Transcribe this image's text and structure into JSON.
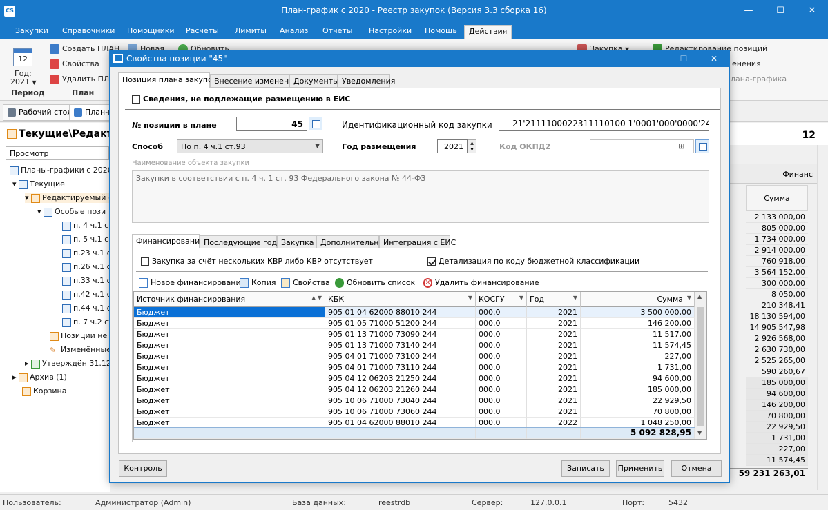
{
  "app": {
    "title": "План-график с 2020 - Реестр закупок (Версия 3.3 сборка 16)",
    "icon_label": "CS",
    "accent": "#1979ca"
  },
  "window_controls": {
    "minimize": "—",
    "maximize": "☐",
    "close": "✕"
  },
  "menu": {
    "items": [
      "Закупки",
      "Справочники",
      "Помощники",
      "Расчёты",
      "Лимиты",
      "Анализ",
      "Отчёты",
      "Настройки",
      "Помощь",
      "Действия"
    ]
  },
  "ribbon": {
    "year_label": "Год:",
    "year_value": "2021",
    "calendar_day": "12",
    "period_group": "Период",
    "create_plan": "Создать ПЛАН",
    "properties": "Свойства",
    "delete_plan": "Удалить ПЛАН",
    "plan_group": "План",
    "new_label": "Новая",
    "refresh_label": "Обновить",
    "purchase_label": "Закупка",
    "edit_positions": "Редактирование позиций",
    "changes_label": "енения",
    "plan_schedule_group": "лана-графика"
  },
  "doc_tabs": [
    "Рабочий стол",
    "План-г"
  ],
  "tree": {
    "title": "Текущие\\Редакти",
    "view_mode": "Просмотр",
    "items": [
      "Планы-графики с 2020",
      "Текущие",
      "Редактируемый (",
      "Особые пози",
      "п. 4 ч.1 с",
      "п. 5 ч.1 с",
      "п.23 ч.1 с",
      "п.26 ч.1 с",
      "п.33 ч.1 с",
      "п.42 ч.1 с",
      "п.44 ч.1 с",
      "п. 7 ч.2 ст",
      "Позиции не д",
      "Изменённые",
      "Утверждён 31.12",
      "Архив (1)",
      "Корзина"
    ]
  },
  "background_table": {
    "count": "12",
    "financing_header": "Финанс",
    "sum_header": "Сумма",
    "values": [
      "2 133 000,00",
      "805 000,00",
      "1 734 000,00",
      "2 914 000,00",
      "760 918,00",
      "3 564 152,00",
      "300 000,00",
      "8 050,00",
      "210 348,41",
      "18 130 594,00",
      "14 905 547,98",
      "2 926 568,00",
      "2 630 730,00",
      "2 525 265,00",
      "590 260,67",
      "185 000,00",
      "94 600,00",
      "146 200,00",
      "70 800,00",
      "22 929,50",
      "1 731,00",
      "227,00",
      "11 574,45"
    ],
    "total": "59 231 263,01"
  },
  "status": {
    "user_label": "Пользователь:",
    "user_value": "Администратор (Admin)",
    "db_label": "База данных:",
    "db_value": "reestrdb",
    "server_label": "Сервер:",
    "server_value": "127.0.0.1",
    "port_label": "Порт:",
    "port_value": "5432"
  },
  "dialog": {
    "title": "Свойства позиции \"45\"",
    "tabs": [
      "Позиция плана закупок",
      "Внесение изменений",
      "Документы",
      "Уведомления"
    ],
    "not_published_label": "Сведения, не подлежащие размещению в ЕИС",
    "not_published_checked": false,
    "position_no_label": "№ позиции в плане",
    "position_no_value": "45",
    "ikz_label": "Идентификационный код закупки",
    "ikz_value": "21'211110002231111010010001000000244",
    "ikz_display": "21'2111100022311110100 1'0001'000'0000'244",
    "method_label": "Способ",
    "method_value": "По п. 4 ч.1 ст.93",
    "year_label": "Год размещения",
    "year_value": "2021",
    "okpd_label": "Код ОКПД2",
    "okpd_value": "",
    "object_name_label": "Наименование объекта закупки",
    "object_name_value": "Закупки в соответствии с п. 4 ч. 1 ст. 93 Федерального закона № 44-ФЗ",
    "inner_tabs": [
      "Финансирование",
      "Последующие годы",
      "Закупка",
      "Дополнительно",
      "Интеграция с ЕИС"
    ],
    "multi_kbr_label": "Закупка за счёт нескольких КВР либо КВР отсутствует",
    "multi_kbr_checked": false,
    "detail_kbk_label": "Детализация по коду бюджетной классификации",
    "detail_kbk_checked": true,
    "toolbar": {
      "new_financing": "Новое финансирование",
      "copy": "Копия",
      "properties": "Свойства",
      "refresh": "Обновить список",
      "delete": "Удалить финансирование"
    },
    "grid": {
      "columns": [
        "Источник финансирования",
        "КБК",
        "КОСГУ",
        "Год",
        "Сумма"
      ],
      "rows": [
        [
          "Бюджет",
          "905 01 04 62000 88010 244",
          "000.0",
          "2021",
          "3 500 000,00"
        ],
        [
          "Бюджет",
          "905 01 05 71000 51200 244",
          "000.0",
          "2021",
          "146 200,00"
        ],
        [
          "Бюджет",
          "905 01 13 71000 73090 244",
          "000.0",
          "2021",
          "11 517,00"
        ],
        [
          "Бюджет",
          "905 01 13 71000 73140 244",
          "000.0",
          "2021",
          "11 574,45"
        ],
        [
          "Бюджет",
          "905 04 01 71000 73100 244",
          "000.0",
          "2021",
          "227,00"
        ],
        [
          "Бюджет",
          "905 04 01 71000 73110 244",
          "000.0",
          "2021",
          "1 731,00"
        ],
        [
          "Бюджет",
          "905 04 12 06203 21250 244",
          "000.0",
          "2021",
          "94 600,00"
        ],
        [
          "Бюджет",
          "905 04 12 06203 21260 244",
          "000.0",
          "2021",
          "185 000,00"
        ],
        [
          "Бюджет",
          "905 10 06 71000 73040 244",
          "000.0",
          "2021",
          "22 929,50"
        ],
        [
          "Бюджет",
          "905 10 06 71000 73060 244",
          "000.0",
          "2021",
          "70 800,00"
        ],
        [
          "Бюджет",
          "905 01 04 62000 88010 244",
          "000.0",
          "2022",
          "1 048 250,00"
        ]
      ],
      "total": "5 092 828,95"
    },
    "buttons": {
      "control": "Контроль",
      "save": "Записать",
      "apply": "Применить",
      "cancel": "Отмена"
    }
  }
}
